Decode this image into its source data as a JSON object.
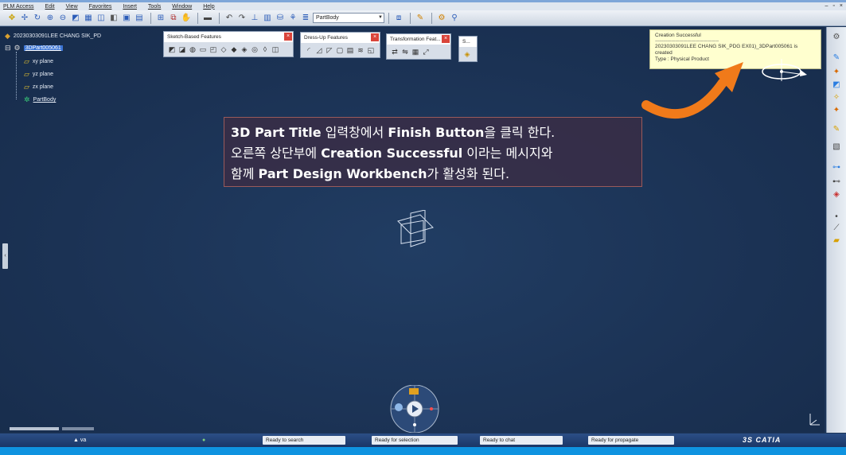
{
  "menubar": {
    "items": [
      "PLM Access",
      "Edit",
      "View",
      "Favorites",
      "Insert",
      "Tools",
      "Window",
      "Help"
    ],
    "window_controls": [
      "–",
      "▫",
      "×"
    ]
  },
  "toolbar": {
    "body_selector": "PartBody"
  },
  "tree": {
    "root": "20230303091LEE CHANG SIK_PD",
    "part": "3DPart005061",
    "xy_plane": "xy plane",
    "yz_plane": "yz plane",
    "zx_plane": "zx plane",
    "part_body": "PartBody"
  },
  "floating_toolbars": {
    "sketch_based": "Sketch-Based Features",
    "dress_up": "Dress-Up Features",
    "transformation": "Transformation Feat...",
    "small": "S..."
  },
  "notification": {
    "title": "Creation Successful",
    "separator": "------------------------------------------------",
    "message": "20230303091LEE CHANG SIK_PDG EX01)_3DPart005061 is created",
    "type_line": "Type : Physical Product"
  },
  "callout": {
    "line1_bold": "3D Part Title",
    "line1_text": " 입력창에서 ",
    "line1_bold2": "Finish Button",
    "line1_tail": "을 클릭 한다.",
    "line2_text": "오른쪽 상단부에 ",
    "line2_bold": "Creation Successful",
    "line2_tail": " 이라는 메시지와",
    "line3_text": "함께 ",
    "line3_bold": "Part Design Workbench",
    "line3_tail": "가 활성화 된다."
  },
  "taskbar": {
    "app_label": "va",
    "search_status": "Ready to search",
    "selection_status": "Ready for selection",
    "chat_status": "Ready to chat",
    "propagate_status": "Ready for propagate",
    "brand": "3S CATIA"
  },
  "colors": {
    "viewport": "#1d3558",
    "arrow": "#f07a1a",
    "selection": "#3b74d4",
    "notification_bg": "#ffffcf"
  }
}
